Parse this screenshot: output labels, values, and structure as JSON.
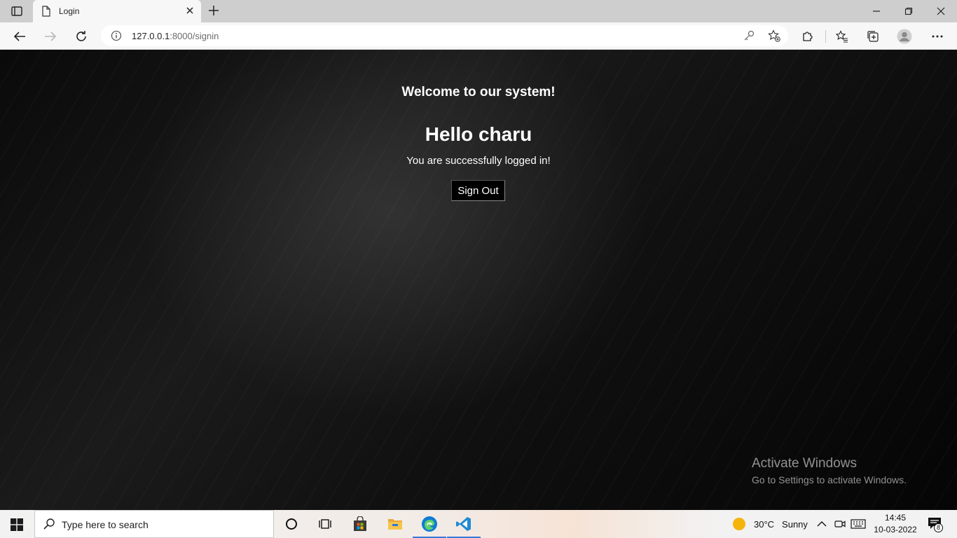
{
  "browser": {
    "tab_title": "Login",
    "url_host": "127.0.0.1",
    "url_rest": ":8000/signin"
  },
  "page": {
    "welcome": "Welcome to our system!",
    "greeting": "Hello charu",
    "message": "You are successfully logged in!",
    "signout_label": "Sign Out"
  },
  "watermark": {
    "line1": "Activate Windows",
    "line2": "Go to Settings to activate Windows."
  },
  "taskbar": {
    "search_placeholder": "Type here to search",
    "weather_temp": "30°C",
    "weather_text": "Sunny",
    "time": "14:45",
    "date": "10-03-2022",
    "notification_count": "8"
  },
  "colors": {
    "accent": "#3b78d8",
    "edge_blue": "#0f7bd6",
    "vscode_blue": "#1f8ad2"
  }
}
